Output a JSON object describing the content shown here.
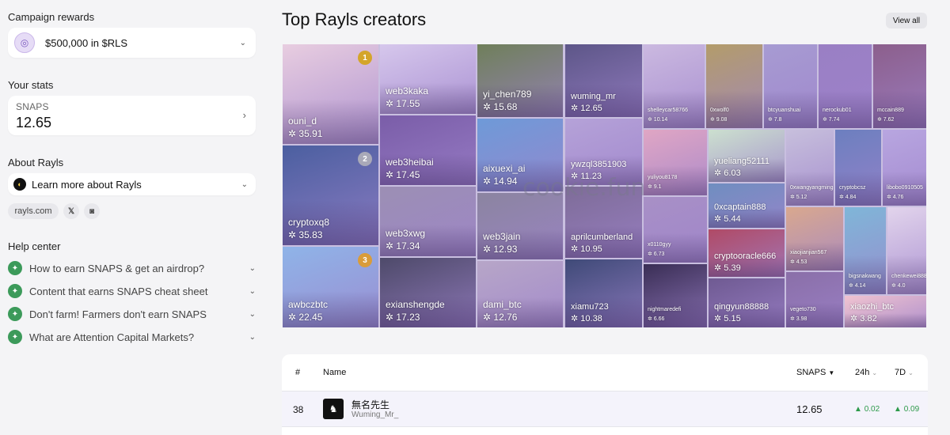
{
  "sidebar": {
    "campaign_title": "Campaign rewards",
    "reward_label": "$500,000 in $RLS",
    "stats_title": "Your stats",
    "stats_label": "SNAPS",
    "stats_value": "12.65",
    "about_title": "About Rayls",
    "about_label": "Learn more about Rayls",
    "site_link": "rayls.com",
    "help_title": "Help center",
    "help_items": [
      "How to earn SNAPS & get an airdrop?",
      "Content that earns SNAPS cheat sheet",
      "Don't farm! Farmers don't earn SNAPS",
      "What are Attention Capital Markets?"
    ]
  },
  "main": {
    "title": "Top Rayls creators",
    "view_all": "View all",
    "watermark": "cookie.fun"
  },
  "creators": [
    {
      "name": "ouni_d",
      "score": "35.91",
      "rank": "1",
      "color": "#e8cde0"
    },
    {
      "name": "cryptoxq8",
      "score": "35.83",
      "rank": "2",
      "color": "#4b5fa0"
    },
    {
      "name": "awbczbtc",
      "score": "22.45",
      "rank": "3",
      "color": "#8fb4e8"
    },
    {
      "name": "web3kaka",
      "score": "17.55",
      "color": "#d6c7ec"
    },
    {
      "name": "web3heibai",
      "score": "17.45",
      "color": "#7a5da8"
    },
    {
      "name": "web3xwg",
      "score": "17.34",
      "color": "#9c8fb4"
    },
    {
      "name": "exianshengde",
      "score": "17.23",
      "color": "#4e4a6a"
    },
    {
      "name": "yi_chen789",
      "score": "15.68",
      "color": "#6f7f5a"
    },
    {
      "name": "aixuexi_ai",
      "score": "14.94",
      "color": "#6e9ad8"
    },
    {
      "name": "web3jain",
      "score": "12.93",
      "color": "#8b84a0"
    },
    {
      "name": "dami_btc",
      "score": "12.76",
      "color": "#b7a6c8"
    },
    {
      "name": "wuming_mr",
      "score": "12.65",
      "color": "#5d5688"
    },
    {
      "name": "ywzql3851903",
      "score": "11.23",
      "color": "#b5a2d8"
    },
    {
      "name": "aprilcumberland",
      "score": "10.95",
      "color": "#7e6c98"
    },
    {
      "name": "xiamu723",
      "score": "10.38",
      "color": "#3f4a78"
    },
    {
      "name": "shelleycar58766",
      "score": "10.14",
      "color": "#cbb9e0"
    },
    {
      "name": "yuliyou8178",
      "score": "9.1",
      "color": "#e0a6c4"
    },
    {
      "name": "x0110gyy",
      "score": "6.73",
      "color": "#a890c6"
    },
    {
      "name": "nightmaredefi",
      "score": "6.66",
      "color": "#3a2e55"
    },
    {
      "name": "0xwolf0",
      "score": "9.08",
      "color": "#b39c6a"
    },
    {
      "name": "btcyuanshuai",
      "score": "7.8",
      "color": "#a79bd2"
    },
    {
      "name": "nerockub01",
      "score": "7.74",
      "color": "#9a7fc4"
    },
    {
      "name": "mccain889",
      "score": "7.62",
      "color": "#8c5f8c"
    },
    {
      "name": "yueliang52111",
      "score": "6.03",
      "color": "#cce0cf"
    },
    {
      "name": "0xcaptain888",
      "score": "5.44",
      "color": "#6f8ec0"
    },
    {
      "name": "cryptooracle666",
      "score": "5.39",
      "color": "#b04a66"
    },
    {
      "name": "qingyun88888",
      "score": "5.15",
      "color": "#6f5a92"
    },
    {
      "name": "0xwangyangming",
      "score": "5.12",
      "color": "#c7bfdc"
    },
    {
      "name": "cryptobcsz",
      "score": "4.84",
      "color": "#6c7fbf"
    },
    {
      "name": "libobo0910505",
      "score": "4.76",
      "color": "#b8a6e0"
    },
    {
      "name": "xiaojianjian567",
      "score": "4.53",
      "color": "#d9a88e"
    },
    {
      "name": "bigsnakwang",
      "score": "4.14",
      "color": "#7fb6d8"
    },
    {
      "name": "chenkewei888",
      "score": "4.0",
      "color": "#e2d4ec"
    },
    {
      "name": "vegeto730",
      "score": "3.98",
      "color": "#8a6fa8"
    },
    {
      "name": "xiaozhi_btc",
      "score": "3.82",
      "color": "#f0c3d0"
    }
  ],
  "table": {
    "headers": {
      "rank": "#",
      "name": "Name",
      "snaps": "SNAPS",
      "h24": "24h",
      "d7": "7D"
    },
    "rows": [
      {
        "rank": "38",
        "avatar": "♞",
        "name": "無名先生",
        "handle": "Wuming_Mr_",
        "snaps": "12.65",
        "change_24h": "0.02",
        "change_7d": "0.09"
      }
    ],
    "up_color": "#2d9a4a"
  }
}
